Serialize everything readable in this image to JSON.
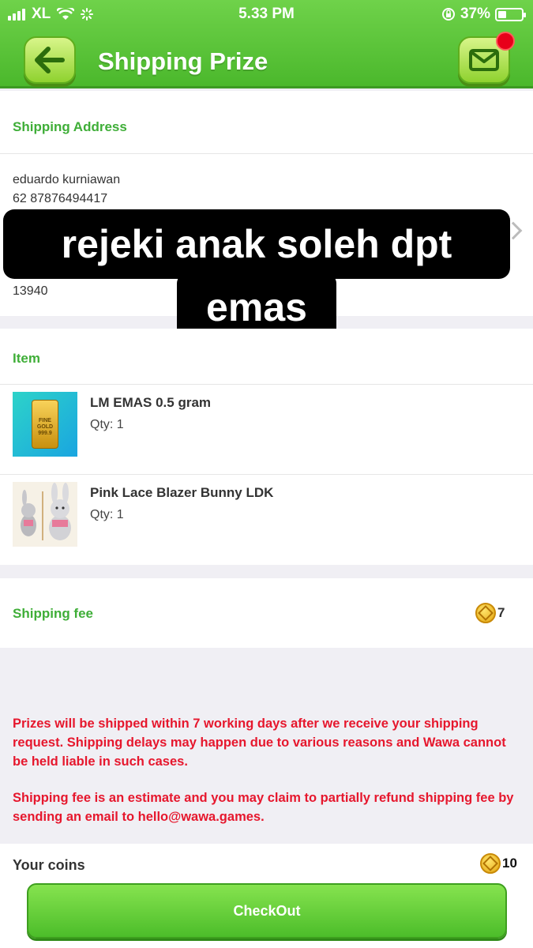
{
  "status_bar": {
    "carrier": "XL",
    "time": "5.33 PM",
    "battery": "37%",
    "battery_fraction": 0.37
  },
  "header": {
    "title": "Shipping Prize",
    "back_icon": "back-arrow-icon",
    "mail_icon": "mail-icon"
  },
  "address": {
    "section_title": "Shipping Address",
    "name": "eduardo kurniawan",
    "phone": "62 87876494417",
    "postal": "13940"
  },
  "overlay": {
    "line1": "rejeki anak soleh dpt",
    "line2": "emas"
  },
  "items": {
    "section_title": "Item",
    "list": [
      {
        "name": "LM EMAS 0.5 gram",
        "qty": "Qty: 1",
        "thumb_text": "FINE GOLD 999.9"
      },
      {
        "name": "Pink Lace Blazer Bunny LDK",
        "qty": "Qty: 1"
      }
    ]
  },
  "shipping_fee": {
    "label": "Shipping fee",
    "value": "7"
  },
  "notice": {
    "p1": "Prizes will be shipped within 7 working days after we receive your shipping request. Shipping delays may happen due to various reasons and Wawa cannot be held liable in such cases.",
    "p2": "Shipping fee is an estimate and you may claim to partially refund shipping fee by sending an email to hello@wawa.games."
  },
  "coins": {
    "label": "Your coins",
    "value": "10"
  },
  "checkout_label": "CheckOut",
  "colors": {
    "accent_green": "#3fae38",
    "notice_red": "#e6172d",
    "header_green": "#5ac536"
  }
}
